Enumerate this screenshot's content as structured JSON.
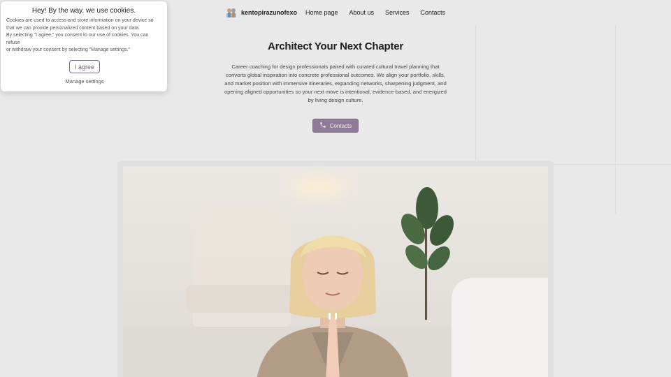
{
  "header": {
    "brand_name": "kentopirazunofexo",
    "nav": [
      "Home page",
      "About us",
      "Services",
      "Contacts"
    ]
  },
  "hero": {
    "title": "Architect Your Next Chapter",
    "description": "Career coaching for design professionals paired with curated cultural travel planning that converts global inspiration into concrete professional outcomes. We align your portfolio, skills, and market position with immersive itineraries, expanding networks, sharpening judgment, and opening aligned opportunities so your next move is intentional, evidence-based, and energized by living design culture.",
    "cta_label": "Contacts",
    "cta_icon": "phone-icon"
  },
  "cookie": {
    "title": "Hey! By the way, we use cookies.",
    "line1": "Cookies are used to access and store information on your device so that we can provide personalized content based on your data.",
    "line2": "By selecting \"I agree,\" you consent to our use of cookies. You can refuse",
    "line3": "or withdraw your consent by selecting \"Manage settings.\"",
    "agree_label": "I agree",
    "manage_label": "Manage settings"
  },
  "colors": {
    "accent": "#8f7b98",
    "background": "#e9e9e9"
  }
}
